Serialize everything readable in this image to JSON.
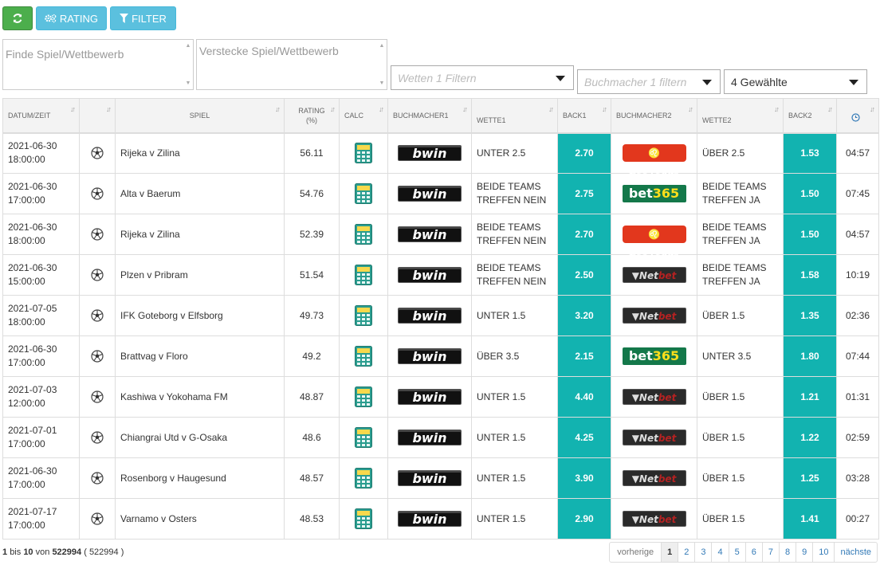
{
  "toolbar": {
    "refresh_icon": "refresh-icon",
    "rating_label": "RATING",
    "filter_label": "FILTER",
    "colors": {
      "refresh": "#4cae4c",
      "accent": "#5bc0de"
    }
  },
  "filters": {
    "find_placeholder": "Finde Spiel/Wettbewerb",
    "hide_placeholder": "Verstecke Spiel/Wettbewerb",
    "bets_placeholder": "Wetten 1 Filtern",
    "bookmaker_placeholder": "Buchmacher 1 filtern",
    "selected_value": "4 Gewählte"
  },
  "table": {
    "headers": {
      "datum": "DATUM/ZEIT",
      "spiel": "SPIEL",
      "rating": "RATING (%)",
      "calc": "CALC",
      "buchmacher1": "BUCHMACHER1",
      "wette1": "WETTE1",
      "back1": "BACK1",
      "buchmacher2": "BUCHMACHER2",
      "wette2": "WETTE2",
      "back2": "BACK2"
    },
    "back_color": "#12b3b0",
    "rows": [
      {
        "date": "2021-06-30",
        "time": "18:00:00",
        "game": "Rijeka v Zilina",
        "rating": "56.11",
        "bm1": "bwin",
        "bet1": "UNTER 2.5",
        "back1": "2.70",
        "bm2": "leovegas",
        "bet2": "ÜBER 2.5",
        "back2": "1.53",
        "remaining": "04:57"
      },
      {
        "date": "2021-06-30",
        "time": "17:00:00",
        "game": "Alta v Baerum",
        "rating": "54.76",
        "bm1": "bwin",
        "bet1": "BEIDE TEAMS TREFFEN NEIN",
        "back1": "2.75",
        "bm2": "bet365",
        "bet2": "BEIDE TEAMS TREFFEN JA",
        "back2": "1.50",
        "remaining": "07:45"
      },
      {
        "date": "2021-06-30",
        "time": "18:00:00",
        "game": "Rijeka v Zilina",
        "rating": "52.39",
        "bm1": "bwin",
        "bet1": "BEIDE TEAMS TREFFEN NEIN",
        "back1": "2.70",
        "bm2": "leovegas",
        "bet2": "BEIDE TEAMS TREFFEN JA",
        "back2": "1.50",
        "remaining": "04:57"
      },
      {
        "date": "2021-06-30",
        "time": "15:00:00",
        "game": "Plzen v Pribram",
        "rating": "51.54",
        "bm1": "bwin",
        "bet1": "BEIDE TEAMS TREFFEN NEIN",
        "back1": "2.50",
        "bm2": "netbet",
        "bet2": "BEIDE TEAMS TREFFEN JA",
        "back2": "1.58",
        "remaining": "10:19"
      },
      {
        "date": "2021-07-05",
        "time": "18:00:00",
        "game": "IFK Goteborg v Elfsborg",
        "rating": "49.73",
        "bm1": "bwin",
        "bet1": "UNTER 1.5",
        "back1": "3.20",
        "bm2": "netbet",
        "bet2": "ÜBER 1.5",
        "back2": "1.35",
        "remaining": "02:36"
      },
      {
        "date": "2021-06-30",
        "time": "17:00:00",
        "game": "Brattvag v Floro",
        "rating": "49.2",
        "bm1": "bwin",
        "bet1": "ÜBER 3.5",
        "back1": "2.15",
        "bm2": "bet365",
        "bet2": "UNTER 3.5",
        "back2": "1.80",
        "remaining": "07:44"
      },
      {
        "date": "2021-07-03",
        "time": "12:00:00",
        "game": "Kashiwa v Yokohama FM",
        "rating": "48.87",
        "bm1": "bwin",
        "bet1": "UNTER 1.5",
        "back1": "4.40",
        "bm2": "netbet",
        "bet2": "ÜBER 1.5",
        "back2": "1.21",
        "remaining": "01:31"
      },
      {
        "date": "2021-07-01",
        "time": "17:00:00",
        "game": "Chiangrai Utd v G-Osaka",
        "rating": "48.6",
        "bm1": "bwin",
        "bet1": "UNTER 1.5",
        "back1": "4.25",
        "bm2": "netbet",
        "bet2": "ÜBER 1.5",
        "back2": "1.22",
        "remaining": "02:59"
      },
      {
        "date": "2021-06-30",
        "time": "17:00:00",
        "game": "Rosenborg v Haugesund",
        "rating": "48.57",
        "bm1": "bwin",
        "bet1": "UNTER 1.5",
        "back1": "3.90",
        "bm2": "netbet",
        "bet2": "ÜBER 1.5",
        "back2": "1.25",
        "remaining": "03:28"
      },
      {
        "date": "2021-07-17",
        "time": "17:00:00",
        "game": "Varnamo v Osters",
        "rating": "48.53",
        "bm1": "bwin",
        "bet1": "UNTER 1.5",
        "back1": "2.90",
        "bm2": "netbet",
        "bet2": "ÜBER 1.5",
        "back2": "1.41",
        "remaining": "00:27"
      }
    ]
  },
  "bookmakers": {
    "bwin": {
      "text": "bwin"
    },
    "leovegas": {
      "text": "LeoVegas"
    },
    "bet365": {
      "text_a": "bet",
      "text_b": "365"
    },
    "netbet": {
      "text_a": "Net",
      "text_b": "bet"
    }
  },
  "footer": {
    "from": "1",
    "bis": "bis",
    "to": "10",
    "von": "von",
    "total": "522994",
    "total_paren": "( 522994 )",
    "prev": "vorherige",
    "next": "nächste",
    "pages": [
      "1",
      "2",
      "3",
      "4",
      "5",
      "6",
      "7",
      "8",
      "9",
      "10"
    ],
    "active_page": "1"
  }
}
